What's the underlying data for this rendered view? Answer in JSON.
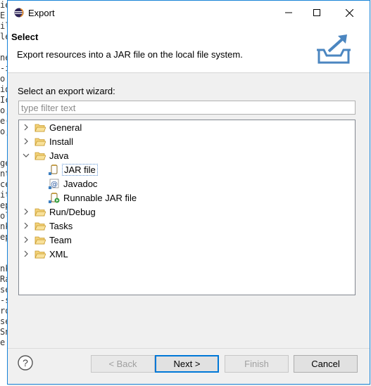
{
  "background_editor": {
    "lines": [
      "ie",
      "E",
      "il",
      "le",
      "",
      "ne",
      "-i",
      "o",
      "id",
      "Ic",
      "o;",
      "e(",
      "o;",
      "",
      "",
      "ge",
      "nt",
      "ce",
      "it",
      "ep",
      "ol",
      "nk",
      "ep",
      "",
      "",
      "nk",
      "Ra",
      "se",
      "-s",
      "ro",
      "se",
      "Sn",
      "e",
      ""
    ]
  },
  "window": {
    "title": "Export",
    "minimize_label": "—",
    "maximize_label": "☐",
    "close_label": "✕"
  },
  "header": {
    "title": "Select",
    "description": "Export resources into a JAR file on the local file system."
  },
  "wizard": {
    "label": "Select an export wizard:",
    "filter_placeholder": "type filter text",
    "filter_value": ""
  },
  "tree": {
    "nodes": [
      {
        "label": "General",
        "expanded": false
      },
      {
        "label": "Install",
        "expanded": false
      },
      {
        "label": "Java",
        "expanded": true
      },
      {
        "label": "JAR file",
        "selected": true
      },
      {
        "label": "Javadoc"
      },
      {
        "label": "Runnable JAR file"
      },
      {
        "label": "Run/Debug",
        "expanded": false
      },
      {
        "label": "Tasks",
        "expanded": false
      },
      {
        "label": "Team",
        "expanded": false
      },
      {
        "label": "XML",
        "expanded": false
      }
    ]
  },
  "buttons": {
    "help_label": "?",
    "back": "< Back",
    "next": "Next >",
    "finish": "Finish",
    "cancel": "Cancel"
  },
  "colors": {
    "accent": "#0078d7",
    "folder": "#e8b64a"
  }
}
